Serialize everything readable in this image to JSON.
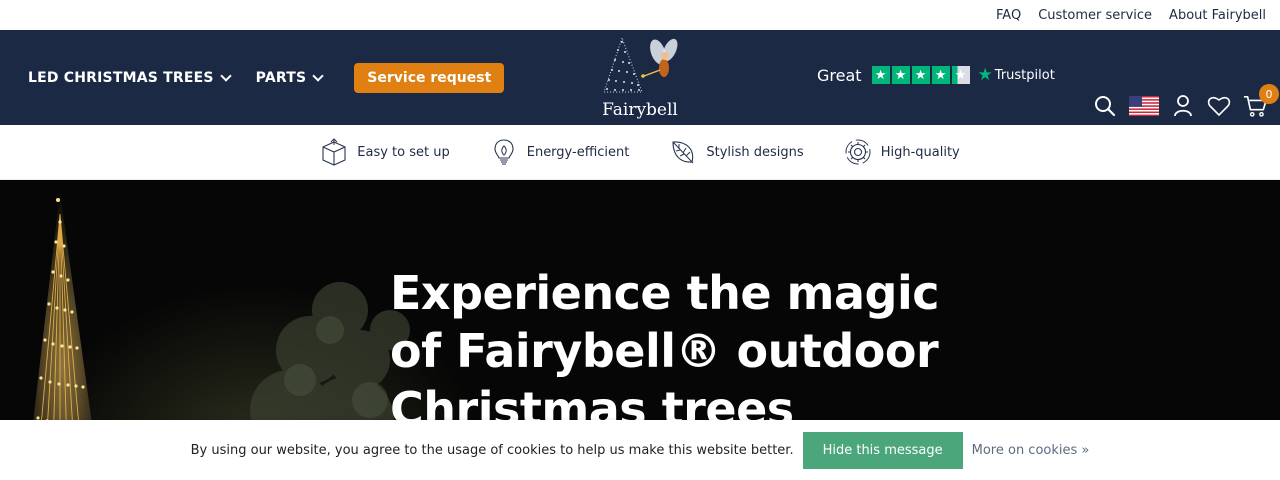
{
  "topbar": {
    "links": [
      "FAQ",
      "Customer service",
      "About Fairybell"
    ]
  },
  "nav": {
    "items": [
      "LED CHRISTMAS TREES",
      "PARTS"
    ],
    "service_request": "Service request",
    "logo_text": "Fairybell",
    "rating_word": "Great",
    "trustpilot": "Trustpilot",
    "trustpilot_stars": 4.3,
    "cart_count": "0"
  },
  "usps": [
    {
      "label": "Easy to set up",
      "icon": "box-icon"
    },
    {
      "label": "Energy-efficient",
      "icon": "lightbulb-icon"
    },
    {
      "label": "Stylish designs",
      "icon": "leaf-icon"
    },
    {
      "label": "High-quality",
      "icon": "gear-icon"
    }
  ],
  "hero": {
    "title_line1": "Experience the magic",
    "title_line2": "of Fairybell® outdoor",
    "title_line3": "Christmas trees"
  },
  "cookie": {
    "text": "By using our website, you agree to the usage of cookies to help us make this website better.",
    "button": "Hide this message",
    "link": "More on cookies »"
  },
  "colors": {
    "navy": "#1b2945",
    "orange": "#e07f12",
    "trustpilot_green": "#00b67a",
    "cookie_green": "#4ca67c"
  }
}
